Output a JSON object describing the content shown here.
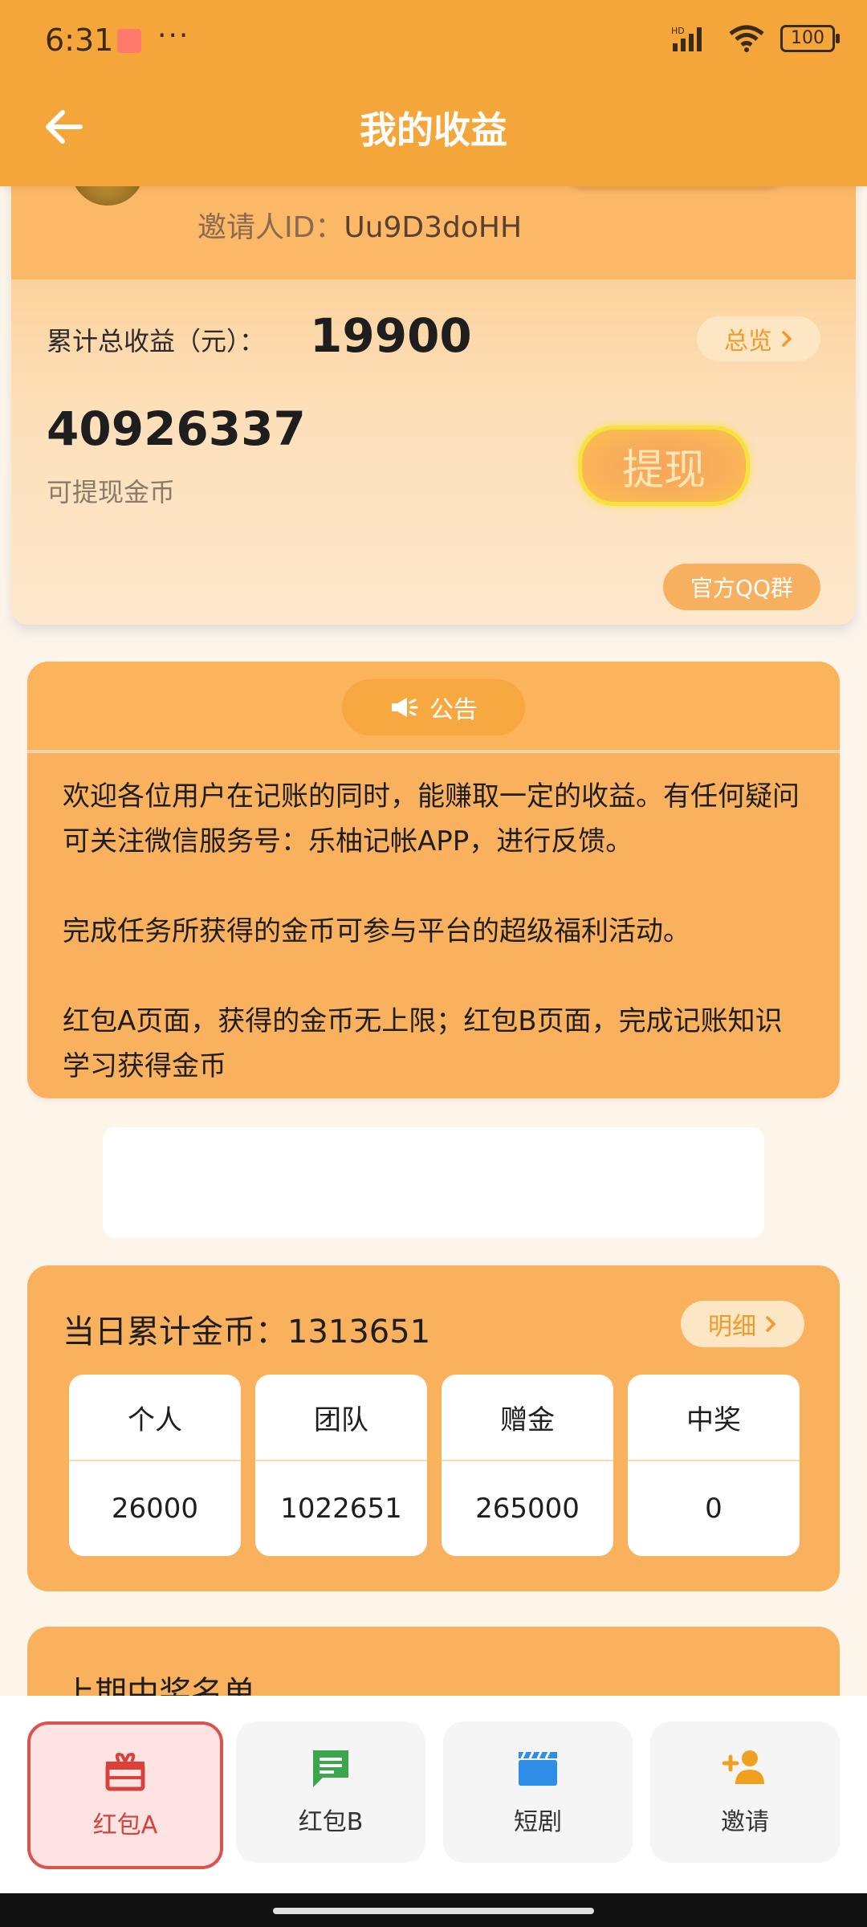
{
  "status": {
    "time": "6:31",
    "dots": "···",
    "battery": "100",
    "signal_label": "HD"
  },
  "header": {
    "title": "我的收益"
  },
  "profile": {
    "inviter_label": "邀请人ID：",
    "inviter_id": "Uu9D3doHH"
  },
  "earnings": {
    "total_label": "累计总收益（元）：",
    "total_value": "19900",
    "overview_label": "总览",
    "coins_value": "40926337",
    "coins_label": "可提现金币",
    "withdraw_label": "提现",
    "qq_group_label": "官方QQ群"
  },
  "notice": {
    "title": "公告",
    "text": "欢迎各位用户在记账的同时，能赚取一定的收益。有任何疑问可关注微信服务号：乐柚记帐APP，进行反馈。\n\n完成任务所获得的金币可参与平台的超级福利活动。\n\n红包A页面，获得的金币无上限；红包B页面，完成记账知识学习获得金币"
  },
  "daily": {
    "title_label": "当日累计金币：",
    "title_value": "1313651",
    "detail_label": "明细",
    "stats": [
      {
        "name": "个人",
        "value": "26000"
      },
      {
        "name": "团队",
        "value": "1022651"
      },
      {
        "name": "赠金",
        "value": "265000"
      },
      {
        "name": "中奖",
        "value": "0"
      }
    ]
  },
  "winners": {
    "title": "上期中奖名单"
  },
  "tabs": [
    {
      "label": "红包A",
      "icon": "gift-icon",
      "color": "#d9413c",
      "active": true
    },
    {
      "label": "红包B",
      "icon": "message-icon",
      "color": "#3aa84a",
      "active": false
    },
    {
      "label": "短剧",
      "icon": "clapperboard-icon",
      "color": "#2f8ee8",
      "active": false
    },
    {
      "label": "邀请",
      "icon": "add-user-icon",
      "color": "#f0a020",
      "active": false
    }
  ],
  "colors": {
    "accent": "#f5a63a",
    "card": "#fab15e",
    "active_tab": "#d9413c"
  }
}
